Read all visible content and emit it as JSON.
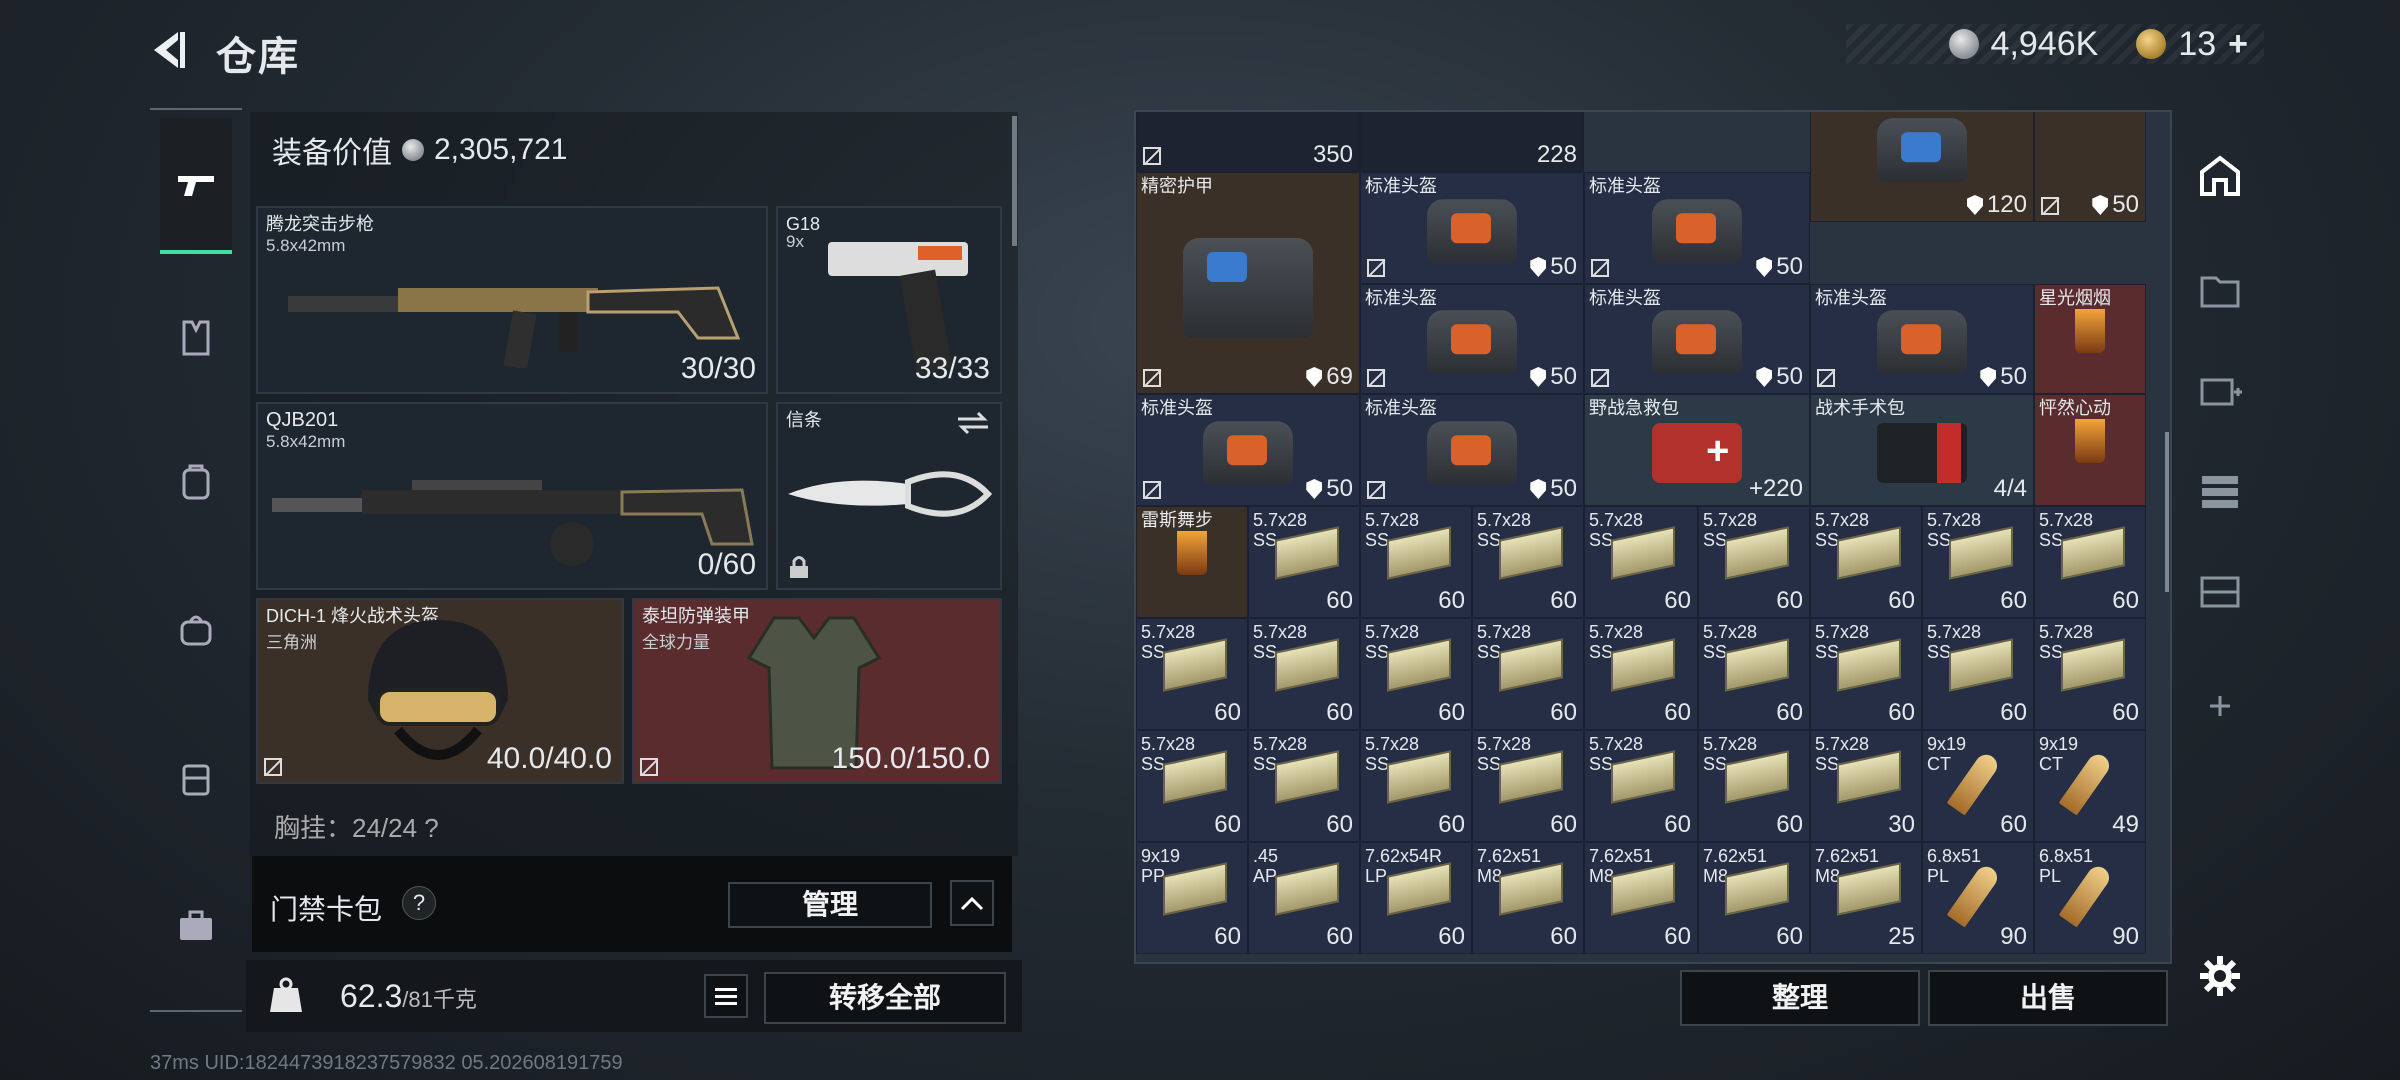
{
  "header": {
    "title": "仓库",
    "currency1": "4,946K",
    "currency2": "13",
    "plus": "+"
  },
  "left_nav": [
    "gun-icon",
    "vest-icon",
    "helmet-icon",
    "backpack-icon",
    "case-icon",
    "toolbox-icon"
  ],
  "loadout": {
    "equip_value_label": "装备价值",
    "equip_value": "2,305,721",
    "slots": {
      "primary": {
        "name": "腾龙突击步枪",
        "caliber": "5.8x42mm",
        "count": "30/30"
      },
      "pistol": {
        "name": "G18",
        "caliber": "9x",
        "count": "33/33"
      },
      "secondary": {
        "name": "QJB201",
        "caliber": "5.8x42mm",
        "count": "0/60"
      },
      "melee": {
        "name": "信条"
      },
      "helmet": {
        "name": "DICH-1 烽火战术头盔",
        "sub": "三角洲",
        "count": "40.0/40.0"
      },
      "armor": {
        "name": "泰坦防弹装甲",
        "sub": "全球力量",
        "count": "150.0/150.0"
      }
    },
    "carry_text": "胸挂：24/24 ?",
    "keycase_label": "门禁卡包",
    "qmark": "?",
    "manage_label": "管理",
    "weight": "62.3",
    "weight_max": "/81千克",
    "transfer_all_label": "转移全部"
  },
  "inventory": {
    "row0": [
      {
        "count": "350"
      },
      {
        "count": "228"
      }
    ],
    "armor1": {
      "name": "精密护甲",
      "dur": "69"
    },
    "armor2": {
      "dur": "120"
    },
    "armor3": {
      "dur": "50"
    },
    "helmet_name": "标准头盔",
    "helmet_dur": "50",
    "medkit": {
      "name": "野战急救包",
      "count": "220"
    },
    "tkit": {
      "name": "战术手术包",
      "count": "4/4"
    },
    "drink1": "星光烟烟",
    "drink2": "怦然心动",
    "drink3": "雷斯舞步",
    "ammo_label": "5.7x28",
    "ammo_sub": "SS",
    "ammo_count": "60",
    "ammo_count_30": "30",
    "a919": "9x19",
    "a919sub": "CT",
    "a919count": "49",
    "row7": [
      {
        "name": "9x19",
        "sub": "PP",
        "count": "60"
      },
      {
        "name": ".45",
        "sub": "AP",
        "count": "60"
      },
      {
        "name": "7.62x54R",
        "sub": "LP",
        "count": "60"
      },
      {
        "name": "7.62x51",
        "sub": "M8",
        "count": "60"
      },
      {
        "name": "7.62x51",
        "sub": "M8",
        "count": "60"
      },
      {
        "name": "7.62x51",
        "sub": "M8",
        "count": "60"
      },
      {
        "name": "7.62x51",
        "sub": "M8",
        "count": "25"
      },
      {
        "name": "6.8x51",
        "sub": "PL",
        "count": "90"
      },
      {
        "name": "6.8x51",
        "sub": "PL",
        "count": "90"
      }
    ],
    "sort_label": "整理",
    "sell_label": "出售"
  },
  "status": "37ms  UID:1824473918237579832 05.202608191759",
  "colors": {
    "accent": "#3fe0a0",
    "panel": "#252e45",
    "brown": "#3b3028",
    "red": "#5a2c2e"
  }
}
